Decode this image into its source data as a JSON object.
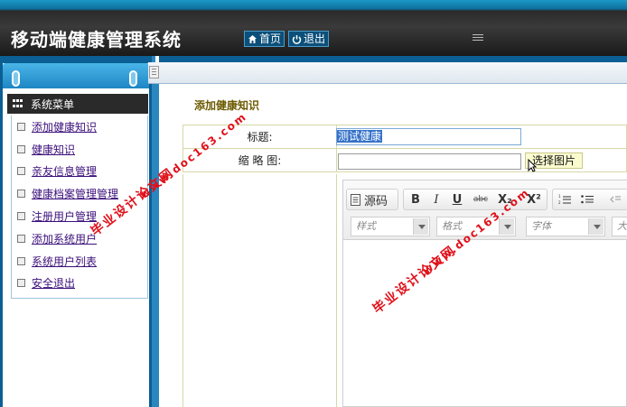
{
  "app": {
    "title": "移动端健康管理系统",
    "nav": {
      "home": "首页",
      "logout": "退出"
    }
  },
  "sidebar": {
    "header": "系统菜单",
    "items": [
      {
        "label": "添加健康知识"
      },
      {
        "label": "健康知识"
      },
      {
        "label": "亲友信息管理"
      },
      {
        "label": "健康档案管理管理"
      },
      {
        "label": "注册用户管理"
      },
      {
        "label": "添加系统用户"
      },
      {
        "label": "系统用户列表"
      },
      {
        "label": "安全退出"
      }
    ]
  },
  "form": {
    "heading": "添加健康知识",
    "title_label": "标题:",
    "title_value": "测试健康",
    "thumbnail_label": "缩 略 图:",
    "thumbnail_value": "",
    "pick_image_button": "选择图片"
  },
  "editor": {
    "source_label": "源码",
    "bold": "B",
    "italic": "I",
    "underline": "U",
    "strike": "abc",
    "subscript": "X₂",
    "superscript": "X²",
    "combos": {
      "style": "样式",
      "format": "格式",
      "font": "字体",
      "size": "大"
    }
  },
  "watermark": {
    "cn": "毕业设计论文网",
    "url": "www.doc163.com"
  },
  "colors": {
    "brand_blue": "#0b5f94",
    "menu_link": "#3b0f7a",
    "heading": "#6b5a00",
    "watermark": "#e0101a"
  }
}
